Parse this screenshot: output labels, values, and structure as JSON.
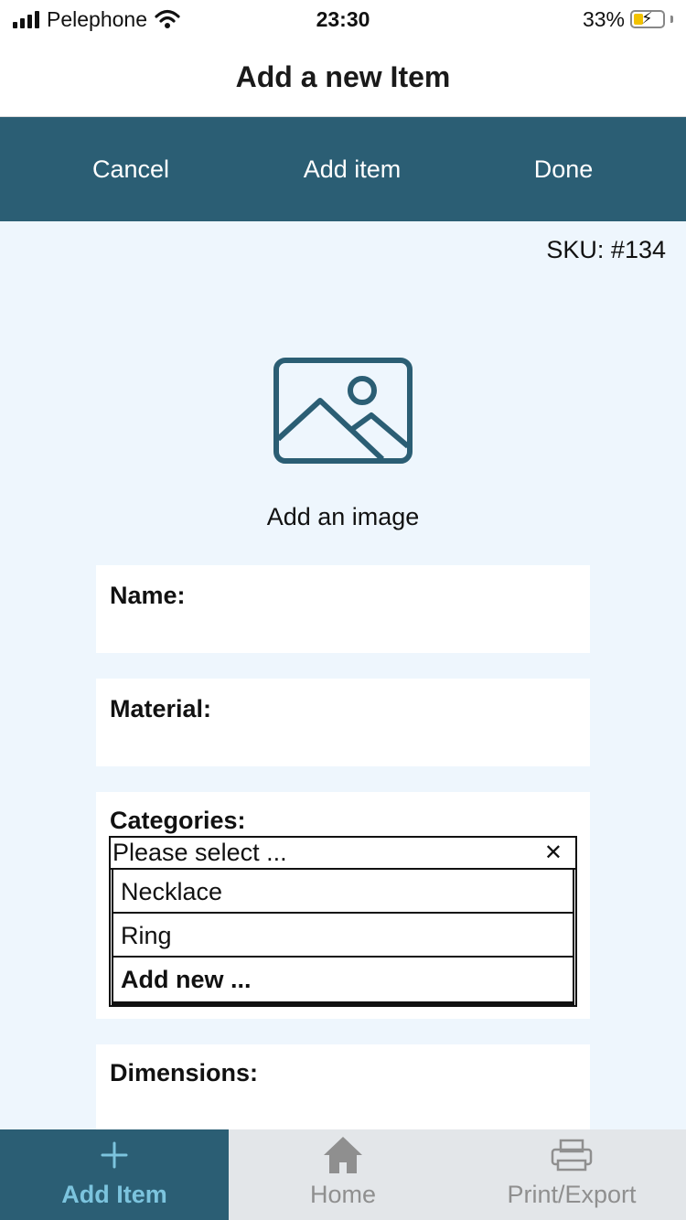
{
  "status_bar": {
    "carrier": "Pelephone",
    "time": "23:30",
    "battery": "33%",
    "battery_level": 0.33
  },
  "header": {
    "title": "Add a new Item"
  },
  "toolbar": {
    "cancel_label": "Cancel",
    "add_item_label": "Add item",
    "done_label": "Done"
  },
  "item": {
    "sku": "SKU: #134",
    "image_label": "Add an image",
    "image_icon": "image-placeholder-icon"
  },
  "fields": {
    "name_label": "Name:",
    "material_label": "Material:",
    "categories_label": "Categories:",
    "dimensions_label": "Dimensions:"
  },
  "categories": {
    "placeholder": "Please select ...",
    "clear_icon": "close-icon",
    "options": [
      "Necklace",
      "Ring",
      "Add new ..."
    ]
  },
  "tabs": [
    {
      "label": "Add Item",
      "icon": "plus-icon",
      "active": true
    },
    {
      "label": "Home",
      "icon": "home-icon",
      "active": false
    },
    {
      "label": "Print/Export",
      "icon": "printer-icon",
      "active": false
    }
  ],
  "colors": {
    "primary": "#2b5e74",
    "background": "#eef6fd",
    "active_tab_text": "#7cc4de",
    "inactive_tab_text": "#8f8f8f",
    "tab_bar": "#e3e6e9"
  }
}
